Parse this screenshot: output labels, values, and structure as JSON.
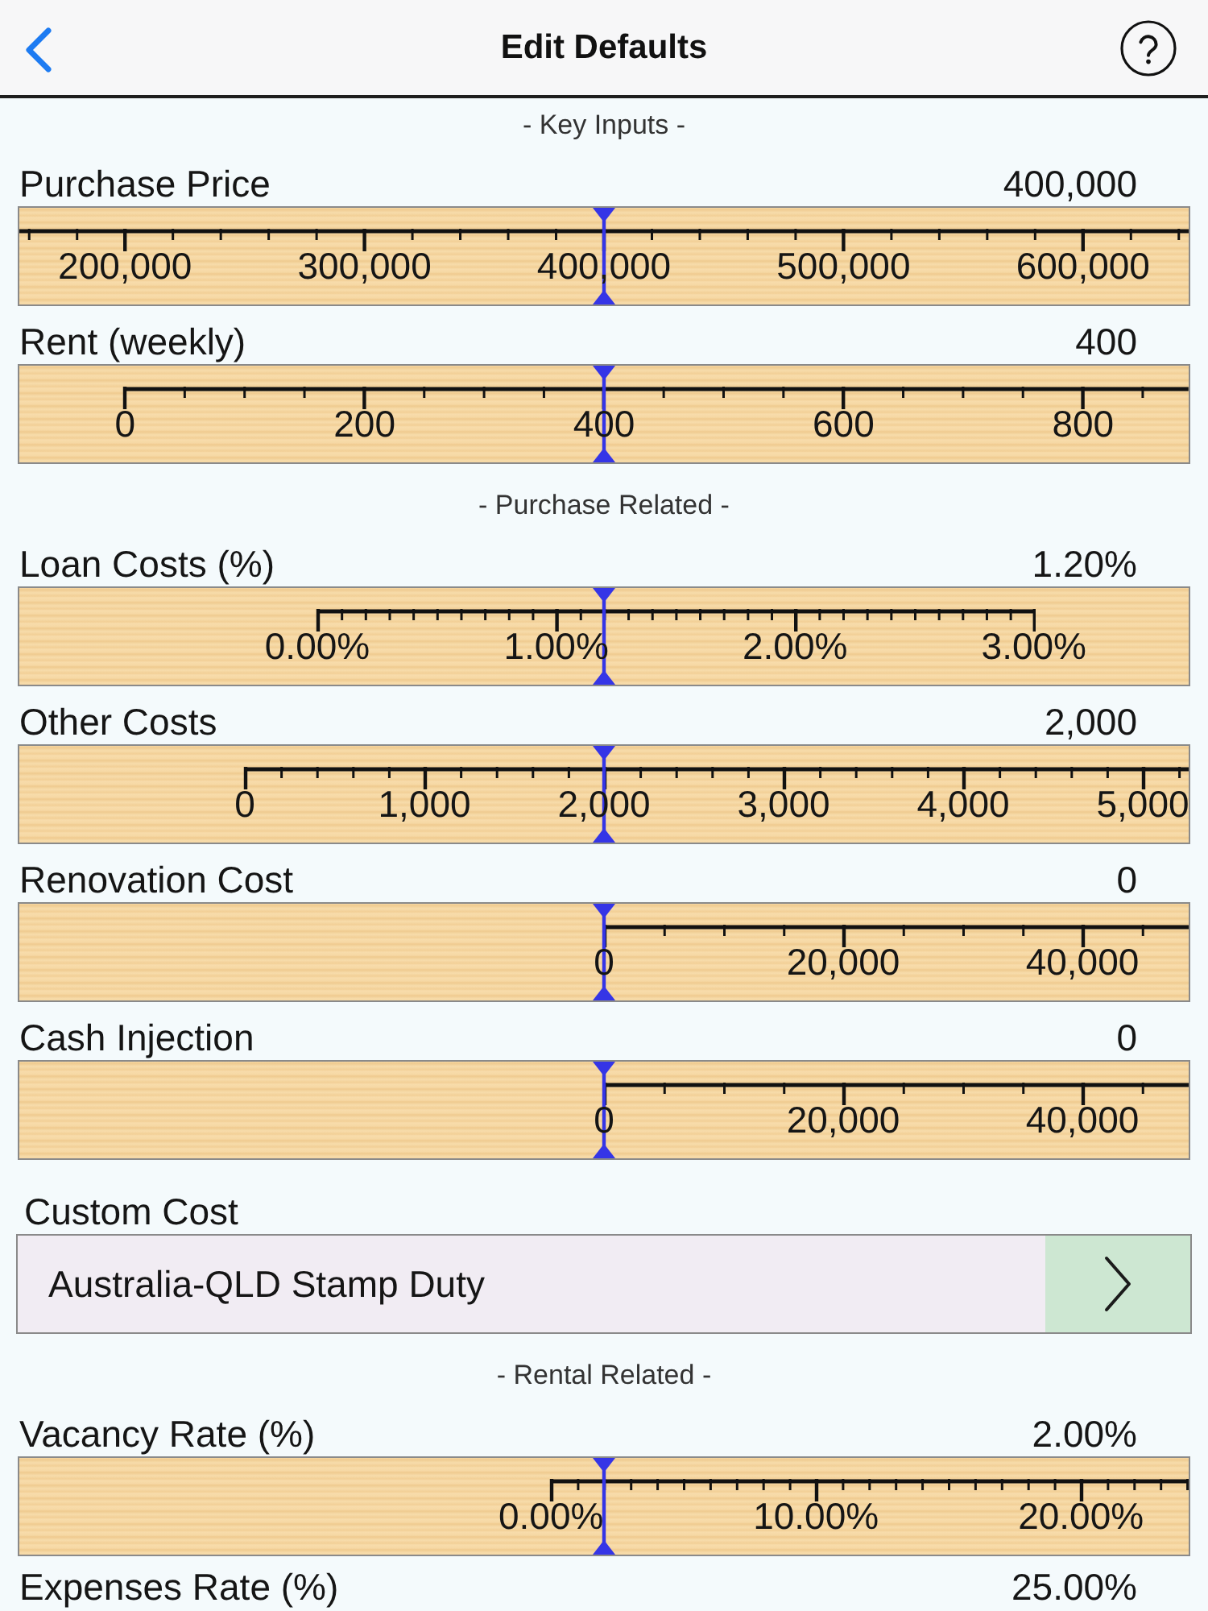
{
  "nav_bar": {
    "title": "Edit Defaults"
  },
  "sections": [
    {
      "heading": "- Key Inputs -",
      "rows": [
        {
          "kind": "ruler",
          "label": "Purchase Price",
          "value": "400,000",
          "level": 0.5,
          "ticks": [
            "200,000",
            "300,000",
            "400,000",
            "500,000",
            "600,000"
          ]
        },
        {
          "kind": "ruler",
          "label": "Rent (weekly)",
          "value": "400",
          "level": 0.5,
          "ticks": [
            "0",
            "200",
            "400",
            "600",
            "800"
          ]
        }
      ]
    },
    {
      "heading": "- Purchase Related -",
      "rows": [
        {
          "kind": "ruler",
          "label": "Loan Costs (%)",
          "value": "1.20%",
          "level": 0.5,
          "ticks": [
            "0.00%",
            "1.00%",
            "2.00%",
            "3.00%"
          ]
        },
        {
          "kind": "ruler",
          "label": "Other Costs",
          "value": "2,000",
          "level": 0.5,
          "ticks": [
            "0",
            "1,000",
            "2,000",
            "3,000",
            "4,000",
            "5,000"
          ]
        },
        {
          "kind": "ruler",
          "label": "Renovation Cost",
          "value": "0",
          "level": 0.5,
          "ticks": [
            "0",
            "20,000",
            "40,000"
          ]
        },
        {
          "kind": "ruler",
          "label": "Cash Injection",
          "value": "0",
          "level": 0.5,
          "ticks": [
            "0",
            "20,000",
            "40,000"
          ]
        },
        {
          "kind": "picker",
          "label": "Custom Cost",
          "value": "Australia-QLD Stamp Duty"
        }
      ]
    },
    {
      "heading": "- Rental Related -",
      "rows": [
        {
          "kind": "ruler",
          "label": "Vacancy Rate (%)",
          "value": "2.00%",
          "level": 0.5,
          "ticks": [
            "0.00%",
            "10.00%",
            "20.00%"
          ]
        },
        {
          "kind": "ruler",
          "label": "Expenses Rate (%)",
          "value": "25.00%"
        }
      ]
    }
  ]
}
